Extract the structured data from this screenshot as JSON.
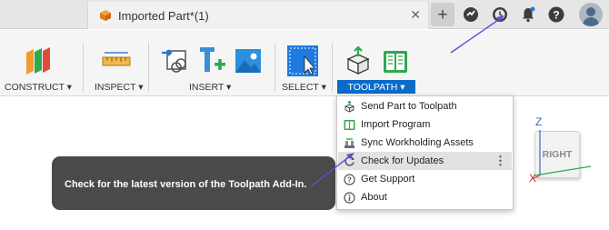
{
  "document_tab": {
    "title": "Imported Part*(1)",
    "close_glyph": "✕"
  },
  "top_right": {
    "new_tab_glyph": "+",
    "icons": [
      "job-status-icon",
      "clock-history-icon",
      "notifications-icon",
      "help-icon",
      "user-avatar"
    ]
  },
  "toolbar": {
    "groups": [
      {
        "label": "CONSTRUCT ▾"
      },
      {
        "label": "INSPECT ▾"
      },
      {
        "label": "INSERT ▾"
      },
      {
        "label": "SELECT ▾"
      },
      {
        "label": "TOOLPATH ▾"
      }
    ]
  },
  "toolpath_menu": {
    "items": [
      {
        "label": "Send Part to Toolpath"
      },
      {
        "label": "Import Program"
      },
      {
        "label": "Sync Workholding Assets"
      },
      {
        "label": "Check for Updates"
      },
      {
        "label": "Get Support"
      },
      {
        "label": "About"
      }
    ],
    "kebab_glyph": "⋮"
  },
  "tooltip": {
    "text": "Check for the latest version of the Toolpath Add-In."
  },
  "viewcube": {
    "face_label": "RIGHT",
    "axis_z": "Z",
    "axis_x": "X"
  },
  "colors": {
    "accent_blue": "#0a6bc9",
    "annotation_arrow": "#5a4fd6",
    "tooltip_bg": "#4a4a4a"
  }
}
